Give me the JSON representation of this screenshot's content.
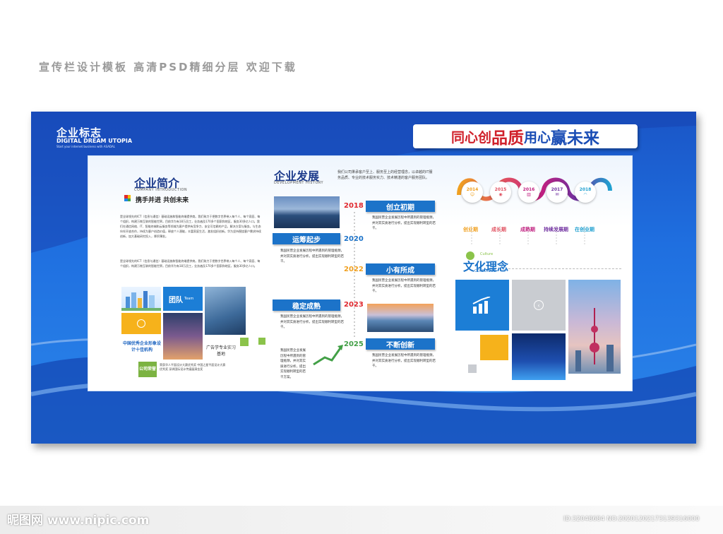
{
  "caption": "宣传栏设计模板 高清PSD精细分层 欢迎下载",
  "logo": {
    "title": "企业标志",
    "sub": "DIGITAL DREAM UTOPIA",
    "tagline": "Start your internet business with ASADAL"
  },
  "slogan": {
    "part1": "同心创",
    "part2": "品质",
    "part3": " 用心",
    "part4": "赢未来"
  },
  "intro": {
    "title": "企业简介",
    "sub": "COMPANY INTRODUCTION",
    "motto": "携手并进 共创未来",
    "para1": "是全球领先的ICT（信息与通信）基础设施和智能终端提供商。我们致力于把数字世界带入每个人、每个家庭、每个组织，构建万物互联的智能世界。目前华为有18万员工，业务遍及170多个国家和地区，服务30多亿人口。我们在通信网络、IT、智能终端和云服务等领域为客户提供有竞争力、安全可信赖的产品、解决方案与服务。与生态伙伴开放合作，持续为客户创造价值，释放个人潜能，丰富家庭生活，激发组织创新。华为坚持围绕客户需求持续创新，加大基础研究投入，厚积薄发。",
    "para2": "是全球领先的ICT（信息与通信）基础设施和智能终端提供商。我们致力于把数字世界带入每个人、每个家庭、每个组织，构建万物互联的智能世界。目前华为有18万员工，业务遍及170多个国家和地区，服务30多亿人口。",
    "tiles": {
      "team": "团队",
      "team_en": "Team",
      "honor": "中国优秀企业形象设计十佳机构",
      "base": "广告学专业实习基地",
      "award": "公司荣誉",
      "award_text": "荣获华人平面设计大赛优秀奖 中国之星平面设计大赛优秀奖 深圳国际设计传媒展演金奖"
    }
  },
  "history": {
    "title": "企业发展",
    "sub": "DEVELOPMENT HISTORY",
    "intro": "我们公司秉承客户至上、服务至上的经营理念，以卓越的IT服务品质、专业的技术服务实力、技术精湛的客户服务团队。",
    "items": [
      {
        "year": "2018",
        "label": "创立初期",
        "text": "我国民营企业发展历程中所遇到的管理瓶颈，并对其实质进行分析，提出实现顺利转型的若干。"
      },
      {
        "year": "2020",
        "label": "运筹起步",
        "text": "我国民营企业发展历程中所遇到的管理瓶颈，并对其实质进行分析，提出实现顺利转型的若干。"
      },
      {
        "year": "2022",
        "label": "小有所成",
        "text": "我国民营企业发展历程中所遇到的管理瓶颈，并对其实质进行分析，提出实现顺利转型的若干。"
      },
      {
        "year": "2023",
        "label": "稳定成熟",
        "text": "我国民营企业发展历程中所遇到的管理瓶颈，并对其实质进行分析，提出实现顺利转型的若干。"
      },
      {
        "year": "2025",
        "label": "不断创新",
        "text": "我国民营企业发展历程中所遇到的管理瓶颈，并对其实质进行分析，提出实现顺利转型的若干。"
      }
    ],
    "extra_text": "我国民营企业发展历程中所遇到的管理瓶颈，并对其实质进行分析，提出实现顺利转型的若干方案。"
  },
  "steps": [
    {
      "year": "2014",
      "label": "创业期",
      "color": "#f0a020"
    },
    {
      "year": "2015",
      "label": "成长期",
      "color": "#e05060"
    },
    {
      "year": "2016",
      "label": "成熟期",
      "color": "#c02080"
    },
    {
      "year": "2017",
      "label": "持续发展期",
      "color": "#7030a0"
    },
    {
      "year": "2018",
      "label": "在创业期",
      "color": "#20a0d0"
    }
  ],
  "culture": {
    "title": "文化理念",
    "en1": "Culture",
    "en2": "CORPORATE"
  },
  "watermark": {
    "left": "昵图网 www.nipic.com",
    "right": "ID:32048684 NO:20201202173139316000"
  }
}
